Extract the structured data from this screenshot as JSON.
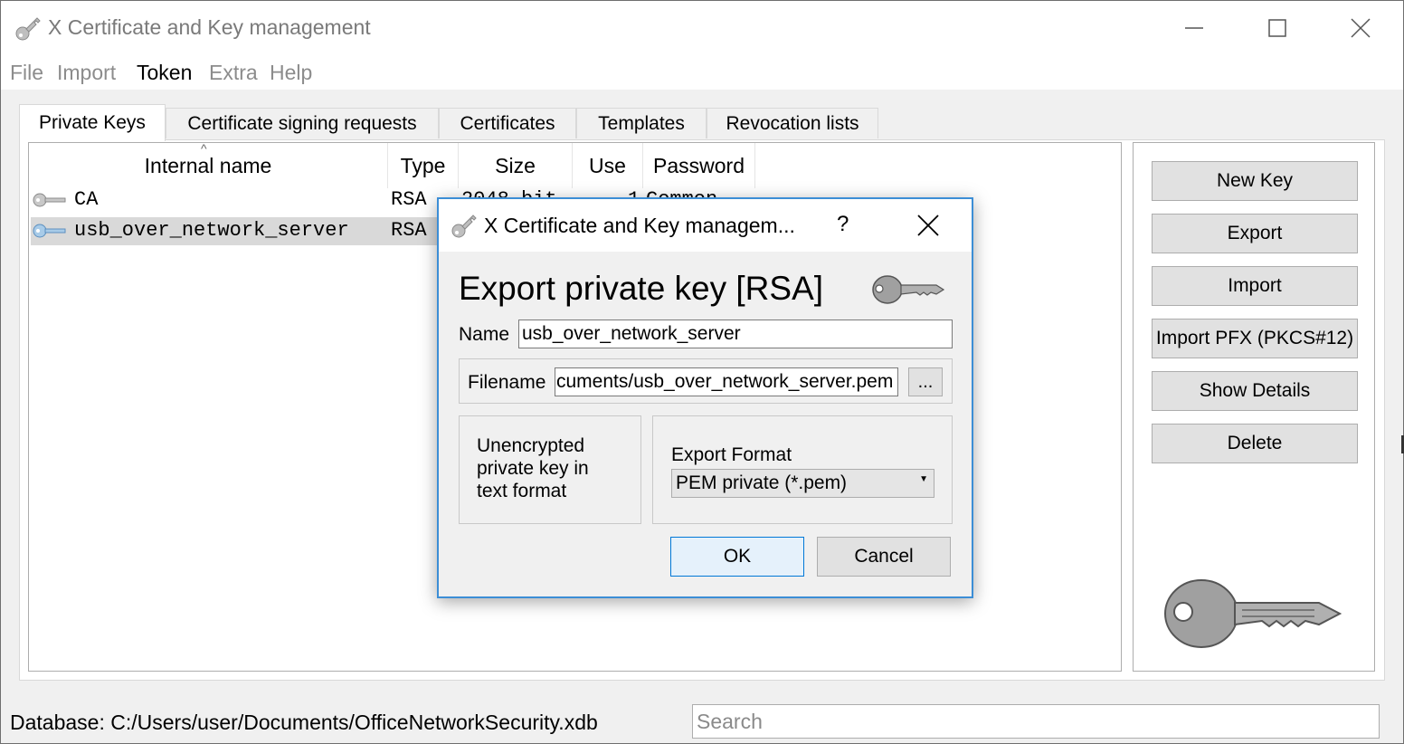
{
  "window": {
    "title": "X Certificate and Key management"
  },
  "menu": {
    "items": [
      "File",
      "Import",
      "Token",
      "Extra",
      "Help"
    ]
  },
  "tabs": [
    "Private Keys",
    "Certificate signing requests",
    "Certificates",
    "Templates",
    "Revocation lists"
  ],
  "table": {
    "columns": [
      "Internal name",
      "Type",
      "Size",
      "Use",
      "Password"
    ],
    "rows": [
      {
        "name": "CA",
        "type": "RSA",
        "size": "2048 bit",
        "use": "1",
        "password": "Common"
      },
      {
        "name": "usb_over_network_server",
        "type": "RSA",
        "size": "",
        "use": "",
        "password": ""
      }
    ]
  },
  "side_buttons": {
    "new_key": "New Key",
    "export": "Export",
    "import": "Import",
    "import_pfx": "Import PFX (PKCS#12)",
    "show_details": "Show Details",
    "delete": "Delete"
  },
  "status": {
    "database": "Database: C:/Users/user/Documents/OfficeNetworkSecurity.xdb",
    "search_placeholder": "Search"
  },
  "dialog": {
    "title": "X Certificate and Key managem...",
    "help": "?",
    "heading": "Export private key [RSA]",
    "name_label": "Name",
    "name_value": "usb_over_network_server",
    "filename_label": "Filename",
    "filename_value": "cuments/usb_over_network_server.pem",
    "browse_label": "...",
    "description": "Unencrypted private key in text format",
    "format_label": "Export Format",
    "format_value": "PEM private (*.pem)",
    "ok": "OK",
    "cancel": "Cancel"
  }
}
